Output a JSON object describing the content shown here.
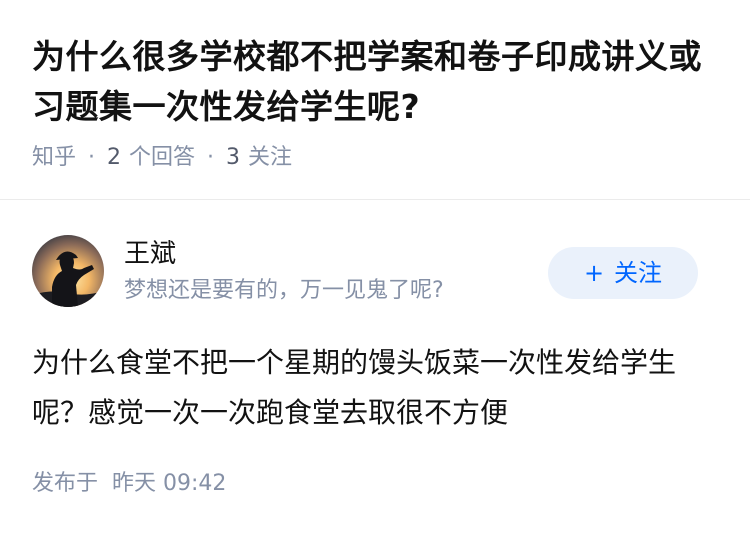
{
  "question": {
    "title": "为什么很多学校都不把学案和卷子印成讲义或习题集一次性发给学生呢?",
    "source": "知乎",
    "answer_count": "2",
    "answer_label": "个回答",
    "follow_count": "3",
    "follow_label": "关注"
  },
  "author": {
    "name": "王斌",
    "bio": "梦想还是要有的，万一见鬼了呢?",
    "follow_button_plus": "+",
    "follow_button_label": "关注"
  },
  "answer": {
    "text": "为什么食堂不把一个星期的馒头饭菜一次性发给学生呢？感觉一次一次跑食堂去取很不方便",
    "published_label": "发布于",
    "published_time": "昨天 09:42"
  },
  "colors": {
    "accent": "#0066ff",
    "follow_bg": "#eaf1fb",
    "meta_gray": "#8590a6",
    "text": "#121212"
  }
}
